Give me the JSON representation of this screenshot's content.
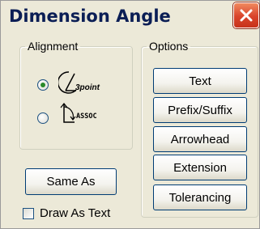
{
  "window": {
    "title": "Dimension Angle"
  },
  "alignment": {
    "legend": "Alignment",
    "options": [
      {
        "label": "3point",
        "selected": true
      },
      {
        "label": "ASSOC",
        "selected": false
      }
    ]
  },
  "options_group": {
    "legend": "Options",
    "buttons": [
      "Text",
      "Prefix/Suffix",
      "Arrowhead",
      "Extension",
      "Tolerancing"
    ]
  },
  "same_as_button": "Same As",
  "draw_as_text": {
    "label": "Draw As Text",
    "checked": false
  },
  "colors": {
    "title_text": "#0b1e55",
    "close_button": "#d9442b",
    "button_border": "#003c74"
  }
}
